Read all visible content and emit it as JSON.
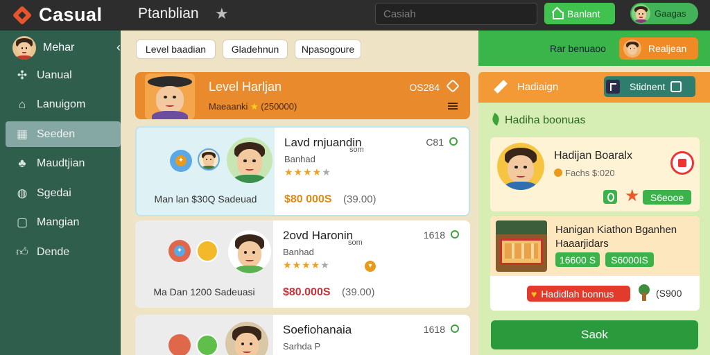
{
  "app": {
    "name": "Casual",
    "page_title": "Ptanblian"
  },
  "search": {
    "placeholder": "Casiah"
  },
  "top_button": {
    "label": "Banlant"
  },
  "user": {
    "name": "Gaagas"
  },
  "sidebar": {
    "user_name": "Mehar",
    "items": [
      {
        "label": "Uanual",
        "icon": "puzzle-icon"
      },
      {
        "label": "Lanuigom",
        "icon": "home-icon"
      },
      {
        "label": "Seeden",
        "icon": "grid-icon",
        "active": true
      },
      {
        "label": "Maudtjian",
        "icon": "club-icon"
      },
      {
        "label": "Sgedai",
        "icon": "chat-icon"
      },
      {
        "label": "Mangian",
        "icon": "calendar-icon"
      },
      {
        "label": "Dende",
        "icon": "thumb-icon"
      }
    ]
  },
  "filters": [
    "Level baadian",
    "Gladehnun",
    "Npasogoure"
  ],
  "banner": {
    "title": "Level Harljan",
    "subtitle_prefix": "Maeaanki",
    "subtitle_suffix": "(250000)",
    "code": "OS284"
  },
  "cards": [
    {
      "title": "Lavd rnjuandin",
      "tsub": "som",
      "sub": "Banhad",
      "num": "C81",
      "rating": 4,
      "price": "$80 000S",
      "old": "(39.00)",
      "caption": "Man lan $30Q Sadeuad",
      "price_color": "#e08a18"
    },
    {
      "title": "2ovd Haronin",
      "tsub": "som",
      "sub": "Banhad",
      "num": "1618",
      "rating": 4,
      "price": "$80.000S",
      "old": "(39.00)",
      "caption": "Ma Dan 1200 Sadeuasi",
      "price_color": "#c8333b"
    },
    {
      "title": "Soefiohanaia",
      "tsub": "",
      "sub": "Sarhda P",
      "num": "1618",
      "rating": 0,
      "price": "",
      "old": "",
      "caption": "",
      "price_color": "#222"
    }
  ],
  "right_panel": {
    "bar_label": "Rar benuaoo",
    "bar_button": "Realjean",
    "header_title": "Hadiaign",
    "segment_label": "Stidnent",
    "section_title": "Hadiha boonuas",
    "offer1": {
      "title": "Hadijan Boaralx",
      "subtitle": "Fachs $:020",
      "tag": "S6eooe"
    },
    "offer2": {
      "title": "Hanigan Kiathon Bganhen Haaarjidars",
      "tag1": "16600 S",
      "tag2": "S6000IS",
      "bonus": "Hadidlah bonnus",
      "points": "(S900"
    },
    "save_label": "Saok"
  },
  "colors": {
    "accent_green": "#3fc24e",
    "accent_orange": "#e98a2c",
    "sidebar": "#2f5e4c"
  }
}
